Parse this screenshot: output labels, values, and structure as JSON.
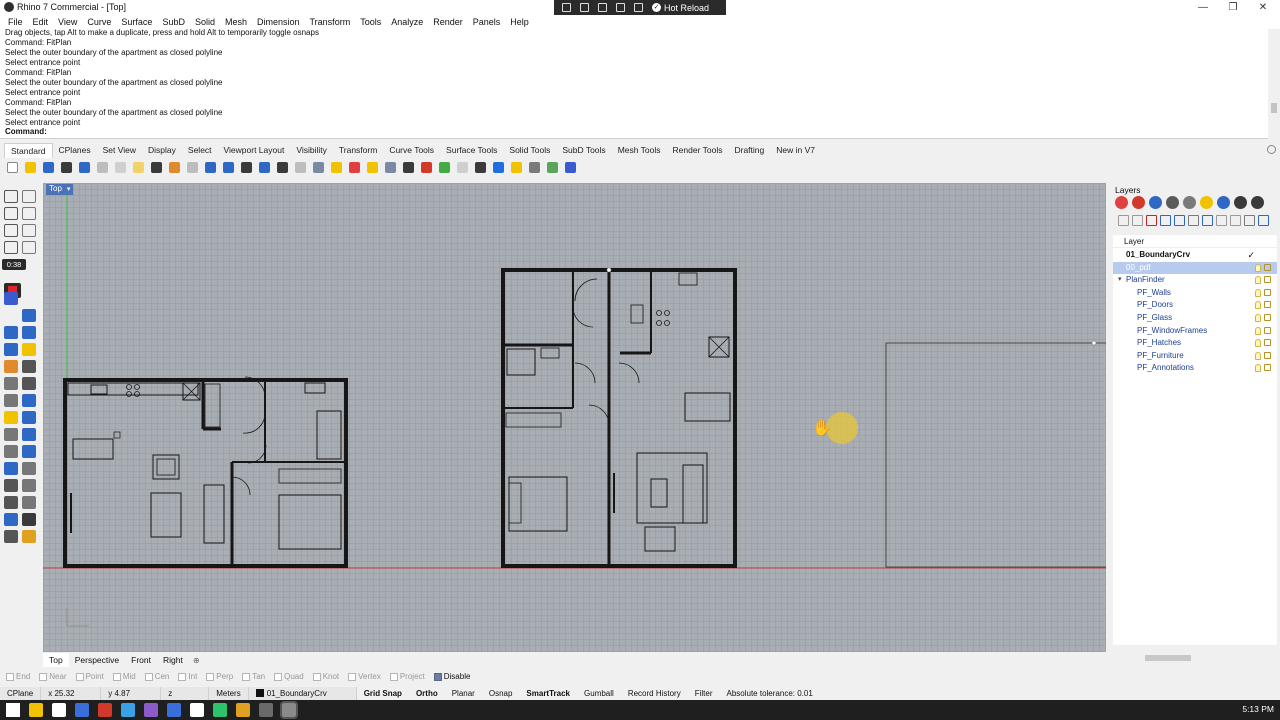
{
  "window": {
    "title": "Rhino 7 Commercial - [Top]",
    "controls": [
      "—",
      "❐",
      "✕"
    ]
  },
  "hot_reload": {
    "label": "Hot Reload"
  },
  "menu": [
    "File",
    "Edit",
    "View",
    "Curve",
    "Surface",
    "SubD",
    "Solid",
    "Mesh",
    "Dimension",
    "Transform",
    "Tools",
    "Analyze",
    "Render",
    "Panels",
    "Help"
  ],
  "command_history": [
    "Drag objects, tap Alt to make a duplicate, press and hold Alt to temporarily toggle osnaps",
    "Command: FitPlan",
    "Select the outer boundary of the apartment as closed polyline",
    "Select entrance point",
    "Command: FitPlan",
    "Select the outer boundary of the apartment as closed polyline",
    "Select entrance point",
    "Command: FitPlan",
    "Select the outer boundary of the apartment as closed polyline",
    "Select entrance point"
  ],
  "command_prompt": "Command:",
  "toolbar_tabs": [
    "Standard",
    "CPlanes",
    "Set View",
    "Display",
    "Select",
    "Viewport Layout",
    "Visibility",
    "Transform",
    "Curve Tools",
    "Surface Tools",
    "Solid Tools",
    "SubD Tools",
    "Mesh Tools",
    "Render Tools",
    "Drafting",
    "New in V7"
  ],
  "toolbar_icon_colors": [
    "#ffffff",
    "#f2c200",
    "#2f67c4",
    "#3a3a3a",
    "#2f67c4",
    "#bdbdbd",
    "#d0d0d0",
    "#f2d26a",
    "#3a3a3a",
    "#e08a2c",
    "#bdbdbd",
    "#2f67c4",
    "#2f67c4",
    "#3a3a3a",
    "#2f67c4",
    "#3a3a3a",
    "#bdbdbd",
    "#7a8aa5",
    "#f0c200",
    "#e04040",
    "#f0c200",
    "#7a8aa5",
    "#3a3a3a",
    "#d13a2b",
    "#44aa44",
    "#cfcfcf",
    "#3a3a3a",
    "#1e6ee0",
    "#f0c200",
    "#7a7a7a",
    "#5aa55a",
    "#3a5ad0"
  ],
  "recording": {
    "timer": "0:38"
  },
  "viewport": {
    "name": "Top"
  },
  "viewport_tabs": [
    "Top",
    "Perspective",
    "Front",
    "Right"
  ],
  "osnaps": [
    {
      "label": "End",
      "on": false
    },
    {
      "label": "Near",
      "on": false
    },
    {
      "label": "Point",
      "on": false
    },
    {
      "label": "Mid",
      "on": false
    },
    {
      "label": "Cen",
      "on": false
    },
    {
      "label": "Int",
      "on": false
    },
    {
      "label": "Perp",
      "on": false
    },
    {
      "label": "Tan",
      "on": false
    },
    {
      "label": "Quad",
      "on": false
    },
    {
      "label": "Knot",
      "on": false
    },
    {
      "label": "Vertex",
      "on": false
    },
    {
      "label": "Project",
      "on": false
    },
    {
      "label": "Disable",
      "on": true
    }
  ],
  "status": {
    "cplane": "CPlane",
    "x": "x 25.32",
    "y": "y 4.87",
    "z": "z",
    "units": "Meters",
    "layer": "01_BoundaryCrv",
    "toggles": [
      {
        "label": "Grid Snap",
        "bold": true
      },
      {
        "label": "Ortho",
        "bold": true
      },
      {
        "label": "Planar",
        "bold": false
      },
      {
        "label": "Osnap",
        "bold": false
      },
      {
        "label": "SmartTrack",
        "bold": true
      },
      {
        "label": "Gumball",
        "bold": false
      },
      {
        "label": "Record History",
        "bold": false
      },
      {
        "label": "Filter",
        "bold": false
      }
    ],
    "tolerance": "Absolute tolerance: 0.01"
  },
  "layers_panel": {
    "title": "Layers",
    "header": "Layer",
    "icon_colors": [
      "#e04040",
      "#d13a2b",
      "#2f67c4",
      "#5a5a5a",
      "#7a7a7a",
      "#f0c200",
      "#2f67c4",
      "#3a3a3a",
      "#3a3a3a"
    ],
    "tool_colors": [
      "#9a9a9a",
      "#9a9a9a",
      "#d12020",
      "#2f67c4",
      "#2f67c4",
      "#7a7a7a",
      "#2f67c4",
      "#9a9a9a",
      "#9a9a9a",
      "#7a7a7a",
      "#2f67c4"
    ],
    "layers": [
      {
        "name": "01_BoundaryCrv",
        "indent": 0,
        "current": true,
        "selected": false,
        "expander": ""
      },
      {
        "name": "00_pdf",
        "indent": 0,
        "current": false,
        "selected": true,
        "expander": ""
      },
      {
        "name": "PlanFinder",
        "indent": 0,
        "current": false,
        "selected": false,
        "expander": "▾"
      },
      {
        "name": "PF_Walls",
        "indent": 1,
        "current": false,
        "selected": false,
        "expander": ""
      },
      {
        "name": "PF_Doors",
        "indent": 1,
        "current": false,
        "selected": false,
        "expander": ""
      },
      {
        "name": "PF_Glass",
        "indent": 1,
        "current": false,
        "selected": false,
        "expander": ""
      },
      {
        "name": "PF_WindowFrames",
        "indent": 1,
        "current": false,
        "selected": false,
        "expander": ""
      },
      {
        "name": "PF_Hatches",
        "indent": 1,
        "current": false,
        "selected": false,
        "expander": ""
      },
      {
        "name": "PF_Furniture",
        "indent": 1,
        "current": false,
        "selected": false,
        "expander": ""
      },
      {
        "name": "PF_Annotations",
        "indent": 1,
        "current": false,
        "selected": false,
        "expander": ""
      }
    ]
  },
  "taskbar": {
    "apps": [
      "#ffffff",
      "#f2c200",
      "#ffffff",
      "#3a6ed8",
      "#d13a2b",
      "#3aa0e8",
      "#8b5cc8",
      "#3a6ed8",
      "#ffffff",
      "#2ec26a",
      "#e0a020",
      "#6a6a6a",
      "#8a8a8a"
    ],
    "clock": "5:13 PM"
  }
}
